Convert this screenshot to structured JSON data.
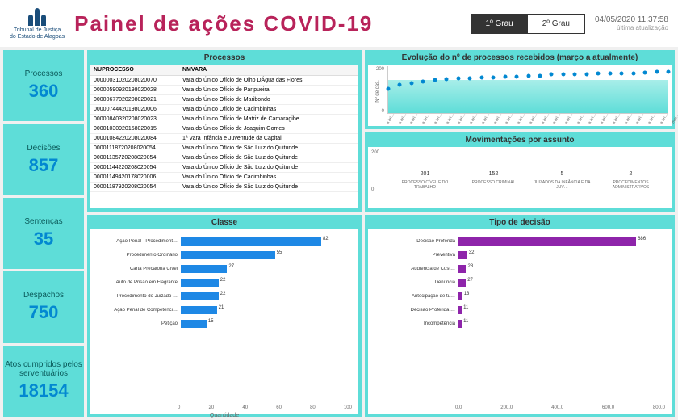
{
  "header": {
    "org_line1": "Tribunal de Justiça",
    "org_line2": "do Estado de Alagoas",
    "title": "Painel de ações COVID-19",
    "tab1": "1º Grau",
    "tab2": "2º Grau",
    "timestamp": "04/05/2020 11:37:58",
    "ts_label": "última atualização"
  },
  "kpis": [
    {
      "label": "Processos",
      "value": "360"
    },
    {
      "label": "Decisões",
      "value": "857"
    },
    {
      "label": "Sentenças",
      "value": "35"
    },
    {
      "label": "Despachos",
      "value": "750"
    },
    {
      "label": "Atos cumpridos pelos serventuários",
      "value": "18154"
    }
  ],
  "table": {
    "title": "Processos",
    "col1": "NUPROCESSO",
    "col2": "NMVARA",
    "rows": [
      [
        "00000031020208020070",
        "Vara do Único Ofício de Olho DÁgua das Flores"
      ],
      [
        "00000590920198020028",
        "Vara do Único Ofício de Paripueira"
      ],
      [
        "00000677020208020021",
        "Vara do Único Ofício de Maribondo"
      ],
      [
        "00000744420198020006",
        "Vara do Único Ofício de Cacimbinhas"
      ],
      [
        "00000840320208020023",
        "Vara do Único Ofício de Matriz de Camaragibe"
      ],
      [
        "00001030920158020015",
        "Vara do Único Ofício de Joaquim Gomes"
      ],
      [
        "00001084220208020084",
        "1ª Vara Infância e Juventude da Capital"
      ],
      [
        "00001118720208020054",
        "Vara do Único Ofício de São Luiz do Quitunde"
      ],
      [
        "00001135720208020054",
        "Vara do Único Ofício de São Luiz do Quitunde"
      ],
      [
        "00001144220208020054",
        "Vara do Único Ofício de São Luiz do Quitunde"
      ],
      [
        "00001149420178020006",
        "Vara do Único Ofício de Cacimbinhas"
      ],
      [
        "00001187920208020054",
        "Vara do Único Ofício de São Luiz do Quitunde"
      ]
    ]
  },
  "chart_data": [
    {
      "type": "area",
      "title": "Evolução do nº de processos recebidos (março a atualmente)",
      "ylabel": "Nº de cas.",
      "ylim": [
        0,
        250
      ],
      "yticks": [
        0,
        200
      ],
      "categories": [
        "a bri…",
        "a bri…",
        "a bri…",
        "a bri…",
        "a bri…",
        "a bri…",
        "a bri…",
        "a bri…",
        "a bri…",
        "a bri…",
        "a bri…",
        "a bri…",
        "a bri…",
        "a bri…",
        "a bri…",
        "a bri…",
        "a bri…",
        "a bri…",
        "a bri…",
        "a bri…",
        "a bri…",
        "a bri…",
        "a bri…",
        "a bri…",
        "mai…"
      ],
      "values": [
        130,
        150,
        160,
        170,
        175,
        180,
        185,
        185,
        190,
        190,
        195,
        195,
        200,
        200,
        205,
        205,
        208,
        208,
        210,
        210,
        212,
        212,
        215,
        218,
        220
      ]
    },
    {
      "type": "bar",
      "title": "Movimentações por assunto",
      "ylim": [
        0,
        220
      ],
      "yticks": [
        0,
        200
      ],
      "categories": [
        "PROCESSO CÍVEL E DO TRABALHO",
        "PROCESSO CRIMINAL",
        "JUIZADOS DA INFÂNCIA E DA JUV…",
        "PROCEDIMENTOS ADMINISTRATIVOS"
      ],
      "values": [
        201,
        152,
        5,
        2
      ]
    },
    {
      "type": "bar",
      "orientation": "h",
      "title": "Classe",
      "xlabel": "Quantidade",
      "xlim": [
        0,
        100
      ],
      "xticks": [
        0,
        20,
        40,
        60,
        80,
        100
      ],
      "color": "#1e88e5",
      "categories": [
        "Ação Penal - Procediment…",
        "Procedimento Ordinário",
        "Carta Precatória Cível",
        "Auto de Prisão em Flagrante",
        "Procedimento do Juizado …",
        "Ação Penal de Competênci…",
        "Petição"
      ],
      "values": [
        82,
        55,
        27,
        22,
        22,
        21,
        15
      ]
    },
    {
      "type": "bar",
      "orientation": "h",
      "title": "Tipo de decisão",
      "xlim": [
        0,
        800
      ],
      "xticks": [
        "0,0",
        "200,0",
        "400,0",
        "600,0",
        "800,0"
      ],
      "color": "#8e24aa",
      "categories": [
        "Decisão Proferida",
        "Preventiva",
        "Audiência de Cust…",
        "Denúncia",
        "Antecipação de tu…",
        "Decisão Proferida …",
        "Incompetência"
      ],
      "values": [
        686,
        32,
        28,
        27,
        13,
        11,
        11
      ]
    }
  ]
}
